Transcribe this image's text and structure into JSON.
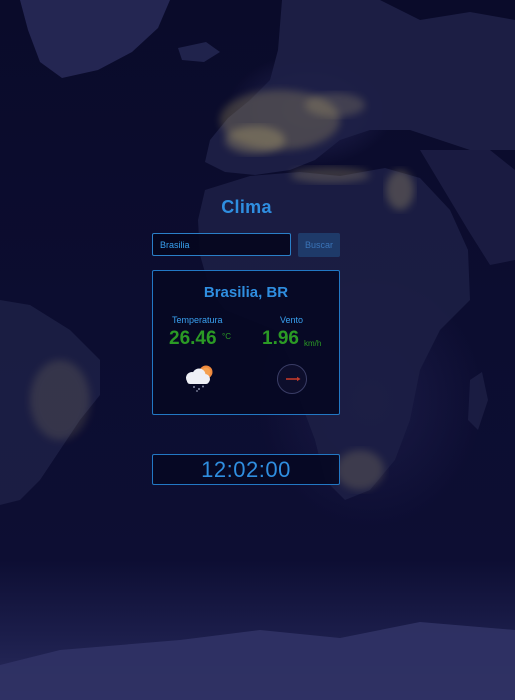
{
  "app": {
    "title": "Clima"
  },
  "search": {
    "value": "Brasilia",
    "button_label": "Buscar"
  },
  "weather": {
    "city": "Brasilia, BR",
    "temperature_label": "Temperatura",
    "temperature_value": "26.46",
    "temperature_unit": "°C",
    "wind_label": "Vento",
    "wind_value": "1.96",
    "wind_unit": "km/h",
    "condition_icon": "partly-cloudy-rain-icon",
    "wind_direction_icon": "wind-direction-compass-icon"
  },
  "clock": {
    "time": "12:02:00"
  },
  "colors": {
    "accent_blue": "#2f8ee0",
    "value_green": "#2b9a25",
    "border_blue": "#2278c4",
    "background_navy": "#0c0d30",
    "compass_needle_red": "#c0392b"
  }
}
